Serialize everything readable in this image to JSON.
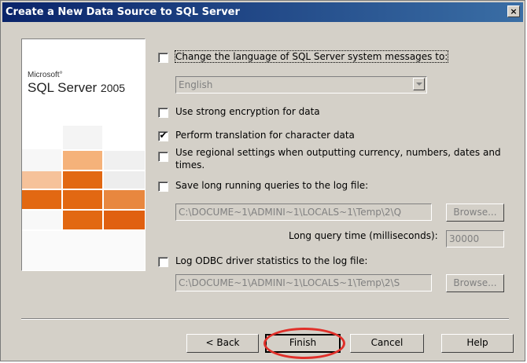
{
  "window": {
    "title": "Create a New Data Source to SQL Server",
    "close_glyph": "×"
  },
  "logo": {
    "ms": "Microsoft°",
    "product": "SQL Server",
    "year": "2005"
  },
  "options": {
    "change_language": {
      "label": "Change the language of SQL Server system messages to:",
      "checked": false
    },
    "language_select": {
      "value": "English"
    },
    "strong_encryption": {
      "label": "Use strong encryption for data",
      "checked": false
    },
    "translation": {
      "label": "Perform translation for character data",
      "checked": true
    },
    "regional": {
      "label_line1": "Use regional settings when outputting currency, numbers, dates and",
      "label_line2": "times.",
      "checked": false
    },
    "long_queries": {
      "label": "Save long running queries to the log file:",
      "checked": false,
      "path": "C:\\DOCUME~1\\ADMINI~1\\LOCALS~1\\Temp\\2\\Q",
      "browse": "Browse..."
    },
    "long_query_time": {
      "label": "Long query time (milliseconds):",
      "value": "30000"
    },
    "odbc_stats": {
      "label": "Log ODBC driver statistics to the log file:",
      "checked": false,
      "path": "C:\\DOCUME~1\\ADMINI~1\\LOCALS~1\\Temp\\2\\S",
      "browse": "Browse..."
    }
  },
  "buttons": {
    "back": "< Back",
    "finish": "Finish",
    "cancel": "Cancel",
    "help": "Help"
  },
  "colors": {
    "title_start": "#0a246a",
    "title_end": "#3a6ea5",
    "dialog": "#d4d0c8",
    "orange": "#e06010",
    "highlight": "#e0302a"
  }
}
